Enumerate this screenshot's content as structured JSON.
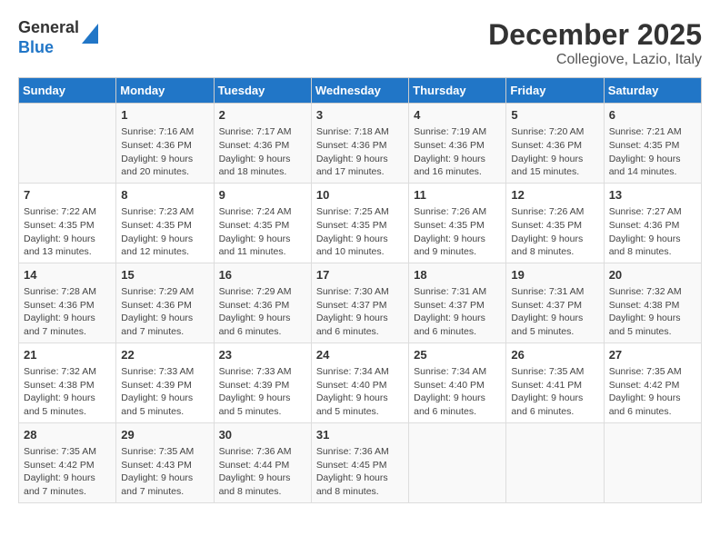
{
  "header": {
    "logo_line1": "General",
    "logo_line2": "Blue",
    "title": "December 2025",
    "subtitle": "Collegiove, Lazio, Italy"
  },
  "days_of_week": [
    "Sunday",
    "Monday",
    "Tuesday",
    "Wednesday",
    "Thursday",
    "Friday",
    "Saturday"
  ],
  "weeks": [
    [
      {
        "day": "",
        "lines": []
      },
      {
        "day": "1",
        "lines": [
          "Sunrise: 7:16 AM",
          "Sunset: 4:36 PM",
          "Daylight: 9 hours",
          "and 20 minutes."
        ]
      },
      {
        "day": "2",
        "lines": [
          "Sunrise: 7:17 AM",
          "Sunset: 4:36 PM",
          "Daylight: 9 hours",
          "and 18 minutes."
        ]
      },
      {
        "day": "3",
        "lines": [
          "Sunrise: 7:18 AM",
          "Sunset: 4:36 PM",
          "Daylight: 9 hours",
          "and 17 minutes."
        ]
      },
      {
        "day": "4",
        "lines": [
          "Sunrise: 7:19 AM",
          "Sunset: 4:36 PM",
          "Daylight: 9 hours",
          "and 16 minutes."
        ]
      },
      {
        "day": "5",
        "lines": [
          "Sunrise: 7:20 AM",
          "Sunset: 4:36 PM",
          "Daylight: 9 hours",
          "and 15 minutes."
        ]
      },
      {
        "day": "6",
        "lines": [
          "Sunrise: 7:21 AM",
          "Sunset: 4:35 PM",
          "Daylight: 9 hours",
          "and 14 minutes."
        ]
      }
    ],
    [
      {
        "day": "7",
        "lines": [
          "Sunrise: 7:22 AM",
          "Sunset: 4:35 PM",
          "Daylight: 9 hours",
          "and 13 minutes."
        ]
      },
      {
        "day": "8",
        "lines": [
          "Sunrise: 7:23 AM",
          "Sunset: 4:35 PM",
          "Daylight: 9 hours",
          "and 12 minutes."
        ]
      },
      {
        "day": "9",
        "lines": [
          "Sunrise: 7:24 AM",
          "Sunset: 4:35 PM",
          "Daylight: 9 hours",
          "and 11 minutes."
        ]
      },
      {
        "day": "10",
        "lines": [
          "Sunrise: 7:25 AM",
          "Sunset: 4:35 PM",
          "Daylight: 9 hours",
          "and 10 minutes."
        ]
      },
      {
        "day": "11",
        "lines": [
          "Sunrise: 7:26 AM",
          "Sunset: 4:35 PM",
          "Daylight: 9 hours",
          "and 9 minutes."
        ]
      },
      {
        "day": "12",
        "lines": [
          "Sunrise: 7:26 AM",
          "Sunset: 4:35 PM",
          "Daylight: 9 hours",
          "and 8 minutes."
        ]
      },
      {
        "day": "13",
        "lines": [
          "Sunrise: 7:27 AM",
          "Sunset: 4:36 PM",
          "Daylight: 9 hours",
          "and 8 minutes."
        ]
      }
    ],
    [
      {
        "day": "14",
        "lines": [
          "Sunrise: 7:28 AM",
          "Sunset: 4:36 PM",
          "Daylight: 9 hours",
          "and 7 minutes."
        ]
      },
      {
        "day": "15",
        "lines": [
          "Sunrise: 7:29 AM",
          "Sunset: 4:36 PM",
          "Daylight: 9 hours",
          "and 7 minutes."
        ]
      },
      {
        "day": "16",
        "lines": [
          "Sunrise: 7:29 AM",
          "Sunset: 4:36 PM",
          "Daylight: 9 hours",
          "and 6 minutes."
        ]
      },
      {
        "day": "17",
        "lines": [
          "Sunrise: 7:30 AM",
          "Sunset: 4:37 PM",
          "Daylight: 9 hours",
          "and 6 minutes."
        ]
      },
      {
        "day": "18",
        "lines": [
          "Sunrise: 7:31 AM",
          "Sunset: 4:37 PM",
          "Daylight: 9 hours",
          "and 6 minutes."
        ]
      },
      {
        "day": "19",
        "lines": [
          "Sunrise: 7:31 AM",
          "Sunset: 4:37 PM",
          "Daylight: 9 hours",
          "and 5 minutes."
        ]
      },
      {
        "day": "20",
        "lines": [
          "Sunrise: 7:32 AM",
          "Sunset: 4:38 PM",
          "Daylight: 9 hours",
          "and 5 minutes."
        ]
      }
    ],
    [
      {
        "day": "21",
        "lines": [
          "Sunrise: 7:32 AM",
          "Sunset: 4:38 PM",
          "Daylight: 9 hours",
          "and 5 minutes."
        ]
      },
      {
        "day": "22",
        "lines": [
          "Sunrise: 7:33 AM",
          "Sunset: 4:39 PM",
          "Daylight: 9 hours",
          "and 5 minutes."
        ]
      },
      {
        "day": "23",
        "lines": [
          "Sunrise: 7:33 AM",
          "Sunset: 4:39 PM",
          "Daylight: 9 hours",
          "and 5 minutes."
        ]
      },
      {
        "day": "24",
        "lines": [
          "Sunrise: 7:34 AM",
          "Sunset: 4:40 PM",
          "Daylight: 9 hours",
          "and 5 minutes."
        ]
      },
      {
        "day": "25",
        "lines": [
          "Sunrise: 7:34 AM",
          "Sunset: 4:40 PM",
          "Daylight: 9 hours",
          "and 6 minutes."
        ]
      },
      {
        "day": "26",
        "lines": [
          "Sunrise: 7:35 AM",
          "Sunset: 4:41 PM",
          "Daylight: 9 hours",
          "and 6 minutes."
        ]
      },
      {
        "day": "27",
        "lines": [
          "Sunrise: 7:35 AM",
          "Sunset: 4:42 PM",
          "Daylight: 9 hours",
          "and 6 minutes."
        ]
      }
    ],
    [
      {
        "day": "28",
        "lines": [
          "Sunrise: 7:35 AM",
          "Sunset: 4:42 PM",
          "Daylight: 9 hours",
          "and 7 minutes."
        ]
      },
      {
        "day": "29",
        "lines": [
          "Sunrise: 7:35 AM",
          "Sunset: 4:43 PM",
          "Daylight: 9 hours",
          "and 7 minutes."
        ]
      },
      {
        "day": "30",
        "lines": [
          "Sunrise: 7:36 AM",
          "Sunset: 4:44 PM",
          "Daylight: 9 hours",
          "and 8 minutes."
        ]
      },
      {
        "day": "31",
        "lines": [
          "Sunrise: 7:36 AM",
          "Sunset: 4:45 PM",
          "Daylight: 9 hours",
          "and 8 minutes."
        ]
      },
      {
        "day": "",
        "lines": []
      },
      {
        "day": "",
        "lines": []
      },
      {
        "day": "",
        "lines": []
      }
    ]
  ]
}
